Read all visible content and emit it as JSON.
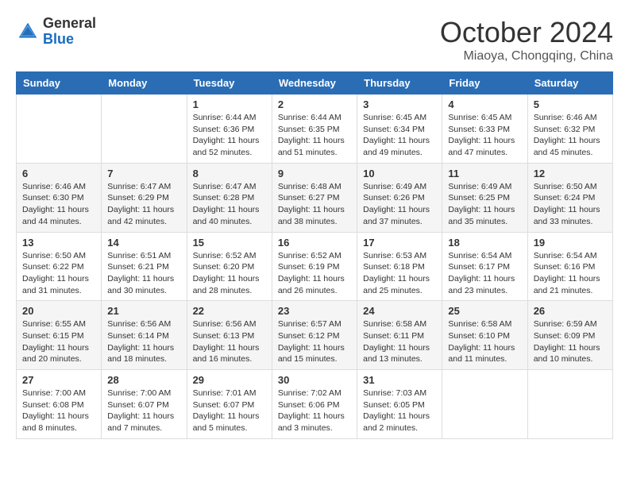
{
  "header": {
    "logo_general": "General",
    "logo_blue": "Blue",
    "month_title": "October 2024",
    "location": "Miaoya, Chongqing, China"
  },
  "days_of_week": [
    "Sunday",
    "Monday",
    "Tuesday",
    "Wednesday",
    "Thursday",
    "Friday",
    "Saturday"
  ],
  "weeks": [
    [
      {
        "day": "",
        "info": ""
      },
      {
        "day": "",
        "info": ""
      },
      {
        "day": "1",
        "info": "Sunrise: 6:44 AM\nSunset: 6:36 PM\nDaylight: 11 hours\nand 52 minutes."
      },
      {
        "day": "2",
        "info": "Sunrise: 6:44 AM\nSunset: 6:35 PM\nDaylight: 11 hours\nand 51 minutes."
      },
      {
        "day": "3",
        "info": "Sunrise: 6:45 AM\nSunset: 6:34 PM\nDaylight: 11 hours\nand 49 minutes."
      },
      {
        "day": "4",
        "info": "Sunrise: 6:45 AM\nSunset: 6:33 PM\nDaylight: 11 hours\nand 47 minutes."
      },
      {
        "day": "5",
        "info": "Sunrise: 6:46 AM\nSunset: 6:32 PM\nDaylight: 11 hours\nand 45 minutes."
      }
    ],
    [
      {
        "day": "6",
        "info": "Sunrise: 6:46 AM\nSunset: 6:30 PM\nDaylight: 11 hours\nand 44 minutes."
      },
      {
        "day": "7",
        "info": "Sunrise: 6:47 AM\nSunset: 6:29 PM\nDaylight: 11 hours\nand 42 minutes."
      },
      {
        "day": "8",
        "info": "Sunrise: 6:47 AM\nSunset: 6:28 PM\nDaylight: 11 hours\nand 40 minutes."
      },
      {
        "day": "9",
        "info": "Sunrise: 6:48 AM\nSunset: 6:27 PM\nDaylight: 11 hours\nand 38 minutes."
      },
      {
        "day": "10",
        "info": "Sunrise: 6:49 AM\nSunset: 6:26 PM\nDaylight: 11 hours\nand 37 minutes."
      },
      {
        "day": "11",
        "info": "Sunrise: 6:49 AM\nSunset: 6:25 PM\nDaylight: 11 hours\nand 35 minutes."
      },
      {
        "day": "12",
        "info": "Sunrise: 6:50 AM\nSunset: 6:24 PM\nDaylight: 11 hours\nand 33 minutes."
      }
    ],
    [
      {
        "day": "13",
        "info": "Sunrise: 6:50 AM\nSunset: 6:22 PM\nDaylight: 11 hours\nand 31 minutes."
      },
      {
        "day": "14",
        "info": "Sunrise: 6:51 AM\nSunset: 6:21 PM\nDaylight: 11 hours\nand 30 minutes."
      },
      {
        "day": "15",
        "info": "Sunrise: 6:52 AM\nSunset: 6:20 PM\nDaylight: 11 hours\nand 28 minutes."
      },
      {
        "day": "16",
        "info": "Sunrise: 6:52 AM\nSunset: 6:19 PM\nDaylight: 11 hours\nand 26 minutes."
      },
      {
        "day": "17",
        "info": "Sunrise: 6:53 AM\nSunset: 6:18 PM\nDaylight: 11 hours\nand 25 minutes."
      },
      {
        "day": "18",
        "info": "Sunrise: 6:54 AM\nSunset: 6:17 PM\nDaylight: 11 hours\nand 23 minutes."
      },
      {
        "day": "19",
        "info": "Sunrise: 6:54 AM\nSunset: 6:16 PM\nDaylight: 11 hours\nand 21 minutes."
      }
    ],
    [
      {
        "day": "20",
        "info": "Sunrise: 6:55 AM\nSunset: 6:15 PM\nDaylight: 11 hours\nand 20 minutes."
      },
      {
        "day": "21",
        "info": "Sunrise: 6:56 AM\nSunset: 6:14 PM\nDaylight: 11 hours\nand 18 minutes."
      },
      {
        "day": "22",
        "info": "Sunrise: 6:56 AM\nSunset: 6:13 PM\nDaylight: 11 hours\nand 16 minutes."
      },
      {
        "day": "23",
        "info": "Sunrise: 6:57 AM\nSunset: 6:12 PM\nDaylight: 11 hours\nand 15 minutes."
      },
      {
        "day": "24",
        "info": "Sunrise: 6:58 AM\nSunset: 6:11 PM\nDaylight: 11 hours\nand 13 minutes."
      },
      {
        "day": "25",
        "info": "Sunrise: 6:58 AM\nSunset: 6:10 PM\nDaylight: 11 hours\nand 11 minutes."
      },
      {
        "day": "26",
        "info": "Sunrise: 6:59 AM\nSunset: 6:09 PM\nDaylight: 11 hours\nand 10 minutes."
      }
    ],
    [
      {
        "day": "27",
        "info": "Sunrise: 7:00 AM\nSunset: 6:08 PM\nDaylight: 11 hours\nand 8 minutes."
      },
      {
        "day": "28",
        "info": "Sunrise: 7:00 AM\nSunset: 6:07 PM\nDaylight: 11 hours\nand 7 minutes."
      },
      {
        "day": "29",
        "info": "Sunrise: 7:01 AM\nSunset: 6:07 PM\nDaylight: 11 hours\nand 5 minutes."
      },
      {
        "day": "30",
        "info": "Sunrise: 7:02 AM\nSunset: 6:06 PM\nDaylight: 11 hours\nand 3 minutes."
      },
      {
        "day": "31",
        "info": "Sunrise: 7:03 AM\nSunset: 6:05 PM\nDaylight: 11 hours\nand 2 minutes."
      },
      {
        "day": "",
        "info": ""
      },
      {
        "day": "",
        "info": ""
      }
    ]
  ]
}
